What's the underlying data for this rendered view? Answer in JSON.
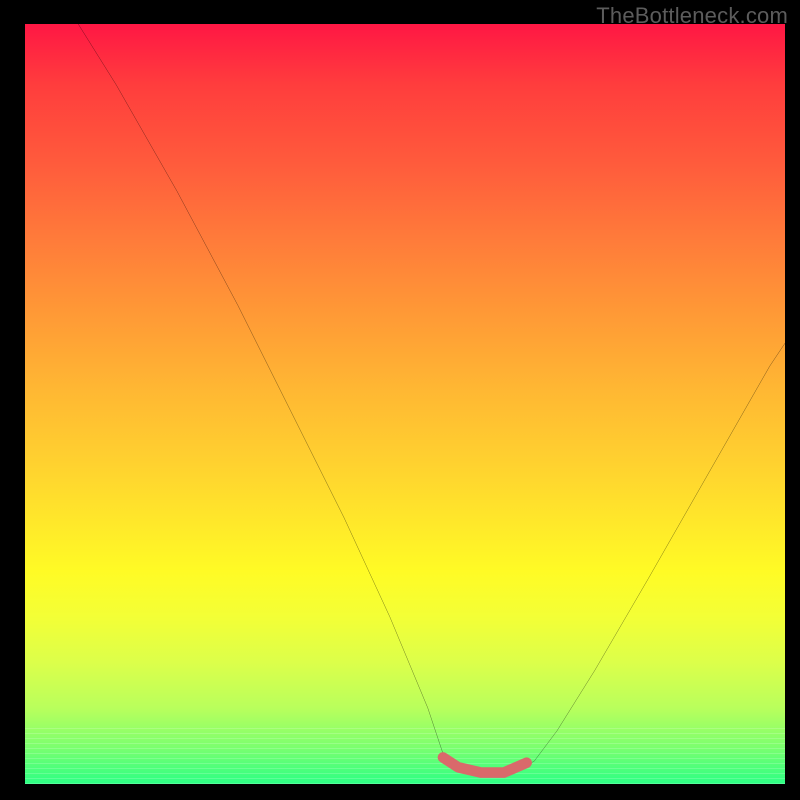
{
  "watermark": "TheBottleneck.com",
  "chart_data": {
    "type": "line",
    "title": "",
    "xlabel": "",
    "ylabel": "",
    "xlim": [
      0,
      100
    ],
    "ylim": [
      0,
      100
    ],
    "series": [
      {
        "name": "curve",
        "x": [
          7,
          12,
          20,
          28,
          35,
          42,
          48,
          53,
          55,
          57,
          60,
          63,
          65,
          67,
          70,
          75,
          82,
          90,
          98,
          100
        ],
        "values": [
          100,
          92,
          78,
          63,
          49,
          35,
          22,
          10,
          4,
          2,
          1.3,
          1.3,
          2,
          3,
          7,
          15,
          27,
          41,
          55,
          58
        ]
      },
      {
        "name": "highlight",
        "x": [
          55,
          57,
          60,
          63,
          66
        ],
        "values": [
          3.5,
          2.2,
          1.5,
          1.5,
          2.8
        ]
      }
    ],
    "colors": {
      "curve": "#000000",
      "highlight": "#d9696b",
      "gradient_top": "#ff1744",
      "gradient_bottom": "#2cff84"
    }
  }
}
